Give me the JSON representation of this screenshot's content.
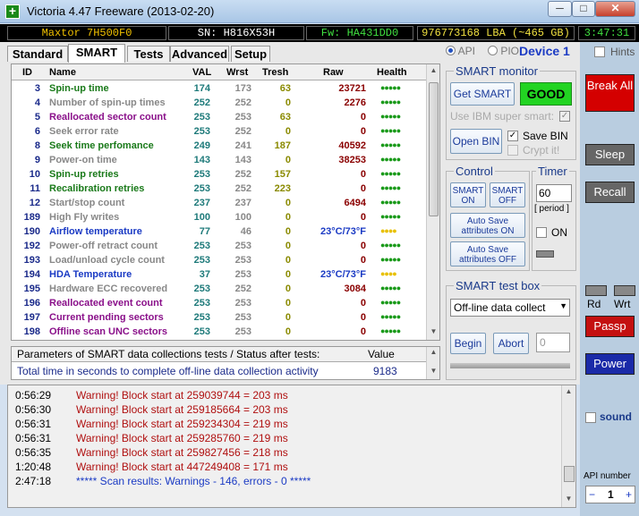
{
  "window": {
    "title": "Victoria 4.47  Freeware (2013-02-20)",
    "min": "─",
    "max": "□",
    "close": "✕"
  },
  "infobar": {
    "model": "Maxtor 7H500F0",
    "serial": "SN: H816X53H",
    "firmware": "Fw: HA431DD0",
    "lba": "976773168 LBA (~465 GB)",
    "clock": "3:47:31"
  },
  "tabs": [
    "Standard",
    "SMART",
    "Tests",
    "Advanced",
    "Setup"
  ],
  "active_tab": "SMART",
  "mode": {
    "api": "API",
    "pio": "PIO",
    "device": "Device 1"
  },
  "hints": "Hints",
  "table": {
    "headers": [
      "ID",
      "Name",
      "VAL",
      "Wrst",
      "Tresh",
      "Raw",
      "Health"
    ],
    "rows": [
      {
        "id": "3",
        "name": "Spin-up time",
        "val": "174",
        "wrst": "173",
        "tresh": "63",
        "raw": "23721",
        "health": "●●●●●",
        "color": "#1a7a1a",
        "hcolor": "#1a9a1a"
      },
      {
        "id": "4",
        "name": "Number of spin-up times",
        "val": "252",
        "wrst": "252",
        "tresh": "0",
        "raw": "2276",
        "health": "●●●●●",
        "color": "#888888",
        "hcolor": "#1a9a1a"
      },
      {
        "id": "5",
        "name": "Reallocated sector count",
        "val": "253",
        "wrst": "253",
        "tresh": "63",
        "raw": "0",
        "health": "●●●●●",
        "color": "#8a108a",
        "hcolor": "#1a9a1a"
      },
      {
        "id": "6",
        "name": "Seek error rate",
        "val": "253",
        "wrst": "252",
        "tresh": "0",
        "raw": "0",
        "health": "●●●●●",
        "color": "#888888",
        "hcolor": "#1a9a1a"
      },
      {
        "id": "8",
        "name": "Seek time perfomance",
        "val": "249",
        "wrst": "241",
        "tresh": "187",
        "raw": "40592",
        "health": "●●●●●",
        "color": "#1a7a1a",
        "hcolor": "#1a9a1a"
      },
      {
        "id": "9",
        "name": "Power-on time",
        "val": "143",
        "wrst": "143",
        "tresh": "0",
        "raw": "38253",
        "health": "●●●●●",
        "color": "#888888",
        "hcolor": "#1a9a1a"
      },
      {
        "id": "10",
        "name": "Spin-up retries",
        "val": "253",
        "wrst": "252",
        "tresh": "157",
        "raw": "0",
        "health": "●●●●●",
        "color": "#1a7a1a",
        "hcolor": "#1a9a1a"
      },
      {
        "id": "11",
        "name": "Recalibration retries",
        "val": "253",
        "wrst": "252",
        "tresh": "223",
        "raw": "0",
        "health": "●●●●●",
        "color": "#1a7a1a",
        "hcolor": "#1a9a1a"
      },
      {
        "id": "12",
        "name": "Start/stop count",
        "val": "237",
        "wrst": "237",
        "tresh": "0",
        "raw": "6494",
        "health": "●●●●●",
        "color": "#888888",
        "hcolor": "#1a9a1a"
      },
      {
        "id": "189",
        "name": "High Fly writes",
        "val": "100",
        "wrst": "100",
        "tresh": "0",
        "raw": "0",
        "health": "●●●●●",
        "color": "#888888",
        "hcolor": "#1a9a1a"
      },
      {
        "id": "190",
        "name": "Airflow temperature",
        "val": "77",
        "wrst": "46",
        "tresh": "0",
        "raw": "23°C/73°F",
        "health": "●●●●",
        "color": "#1a3ac4",
        "hcolor": "#e8c000",
        "rawcolor": "#1a3ac4"
      },
      {
        "id": "192",
        "name": "Power-off retract count",
        "val": "253",
        "wrst": "253",
        "tresh": "0",
        "raw": "0",
        "health": "●●●●●",
        "color": "#888888",
        "hcolor": "#1a9a1a"
      },
      {
        "id": "193",
        "name": "Load/unload cycle count",
        "val": "253",
        "wrst": "253",
        "tresh": "0",
        "raw": "0",
        "health": "●●●●●",
        "color": "#888888",
        "hcolor": "#1a9a1a"
      },
      {
        "id": "194",
        "name": "HDA Temperature",
        "val": "37",
        "wrst": "253",
        "tresh": "0",
        "raw": "23°C/73°F",
        "health": "●●●●",
        "color": "#1a3ac4",
        "hcolor": "#e8c000",
        "rawcolor": "#1a3ac4"
      },
      {
        "id": "195",
        "name": "Hardware ECC recovered",
        "val": "253",
        "wrst": "252",
        "tresh": "0",
        "raw": "3084",
        "health": "●●●●●",
        "color": "#888888",
        "hcolor": "#1a9a1a"
      },
      {
        "id": "196",
        "name": "Reallocated event count",
        "val": "253",
        "wrst": "253",
        "tresh": "0",
        "raw": "0",
        "health": "●●●●●",
        "color": "#8a108a",
        "hcolor": "#1a9a1a"
      },
      {
        "id": "197",
        "name": "Current pending sectors",
        "val": "253",
        "wrst": "253",
        "tresh": "0",
        "raw": "0",
        "health": "●●●●●",
        "color": "#8a108a",
        "hcolor": "#1a9a1a"
      },
      {
        "id": "198",
        "name": "Offline scan UNC sectors",
        "val": "253",
        "wrst": "253",
        "tresh": "0",
        "raw": "0",
        "health": "●●●●●",
        "color": "#8a108a",
        "hcolor": "#1a9a1a"
      }
    ]
  },
  "params": {
    "header": "Parameters of SMART data collections tests / Status after tests:",
    "value_header": "Value",
    "row_label": "Total time in seconds to complete off-line data collection activity",
    "row_value": "9183"
  },
  "smart_monitor": {
    "title": "SMART monitor",
    "get_smart": "Get SMART",
    "status": "GOOD",
    "use_ibm": "Use IBM super smart:",
    "open_bin": "Open BIN",
    "save_bin": "Save BIN",
    "crypt": "Crypt it!"
  },
  "control": {
    "title": "Control",
    "smart_on": "SMART ON",
    "smart_off": "SMART OFF",
    "autosave_on": "Auto Save attributes ON",
    "autosave_off": "Auto Save attributes OFF"
  },
  "timer": {
    "title": "Timer",
    "value": "60",
    "period": "[ period ]",
    "on": "ON"
  },
  "test_box": {
    "title": "SMART test box",
    "selected": "Off-line data collect",
    "begin": "Begin",
    "abort": "Abort",
    "value": "0"
  },
  "right_panel": {
    "break": "Break All",
    "sleep": "Sleep",
    "recall": "Recall",
    "rd": "Rd",
    "wrt": "Wrt",
    "passp": "Passp",
    "power": "Power",
    "sound": "sound",
    "api_number": "API number",
    "api_value": "1",
    "minus": "−",
    "plus": "+"
  },
  "log": [
    {
      "t": "0:56:29",
      "m": "Warning! Block start at 259039744 = 203 ms",
      "c": "#b01010"
    },
    {
      "t": "0:56:30",
      "m": "Warning! Block start at 259185664 = 203 ms",
      "c": "#b01010"
    },
    {
      "t": "0:56:31",
      "m": "Warning! Block start at 259234304 = 219 ms",
      "c": "#b01010"
    },
    {
      "t": "0:56:31",
      "m": "Warning! Block start at 259285760 = 219 ms",
      "c": "#b01010"
    },
    {
      "t": "0:56:35",
      "m": "Warning! Block start at 259827456 = 218 ms",
      "c": "#b01010"
    },
    {
      "t": "1:20:48",
      "m": "Warning! Block start at 447249408 = 171 ms",
      "c": "#b01010"
    },
    {
      "t": "2:47:18",
      "m": "***** Scan results: Warnings - 146, errors - 0 *****",
      "c": "#1a3ac4"
    }
  ]
}
